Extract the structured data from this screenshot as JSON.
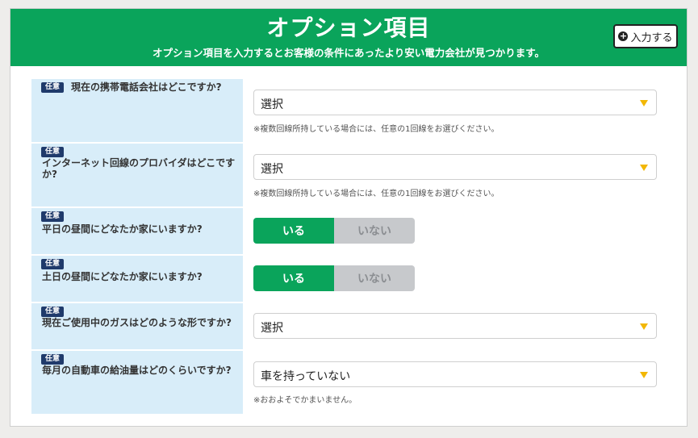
{
  "header": {
    "title": "オプション項目",
    "subtitle": "オプション項目を入力するとお客様の条件にあったより安い電力会社が見つかります。",
    "input_button": "入力する",
    "input_icon": "plus-circle-icon"
  },
  "badge_text": "任意",
  "rows": [
    {
      "type": "select",
      "label": "現在の携帯電話会社はどこですか?",
      "value": "選択",
      "note": "※複数回線所持している場合には、任意の1回線をお選びください。"
    },
    {
      "type": "select",
      "label": "インターネット回線のプロバイダはどこですか?",
      "value": "選択",
      "note": "※複数回線所持している場合には、任意の1回線をお選びください。"
    },
    {
      "type": "toggle",
      "label": "平日の昼間にどなたか家にいますか?",
      "on": "いる",
      "off": "いない"
    },
    {
      "type": "toggle",
      "label": "土日の昼間にどなたか家にいますか?",
      "on": "いる",
      "off": "いない"
    },
    {
      "type": "select",
      "label": "現在ご使用中のガスはどのような形ですか?",
      "value": "選択"
    },
    {
      "type": "select",
      "label": "毎月の自動車の給油量はどのくらいですか?",
      "value": "車を持っていない",
      "note": "※おおよそでかまいません。"
    }
  ],
  "colors": {
    "accent": "#0aa45b",
    "label_bg": "#d8edf9",
    "badge_bg": "#1f3a6b",
    "chevron": "#f2b705"
  }
}
